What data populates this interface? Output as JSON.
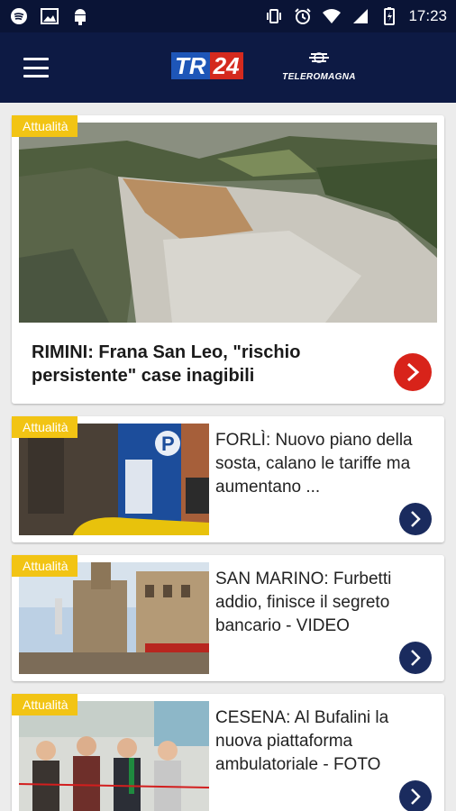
{
  "status_bar": {
    "time": "17:23",
    "left_icons": [
      "spotify-icon",
      "image-icon",
      "android-icon"
    ],
    "right_icons": [
      "vibrate-icon",
      "alarm-icon",
      "wifi-icon",
      "signal-icon",
      "battery-icon"
    ]
  },
  "app_bar": {
    "logo_tr": "TR",
    "logo_24": "24",
    "partner_logo": "TELEROMAGNA"
  },
  "hero": {
    "badge": "Attualità",
    "title": "RIMINI: Frana San Leo, \"rischio persistente\" case inagibili"
  },
  "articles": [
    {
      "badge": "Attualità",
      "title": "FORLÌ: Nuovo piano della sosta, calano le tariffe ma aumentano ..."
    },
    {
      "badge": "Attualità",
      "title": "SAN MARINO: Furbetti addio, finisce il segreto bancario - VIDEO"
    },
    {
      "badge": "Attualità",
      "title": "CESENA: Al Bufalini la nuova piattaforma ambulatoriale - FOTO"
    }
  ],
  "colors": {
    "status_bar_bg": "#0a1436",
    "app_bar_bg": "#0d1a44",
    "badge": "#f2c414",
    "hero_arrow": "#d8231a",
    "article_arrow": "#1a2b5e"
  }
}
